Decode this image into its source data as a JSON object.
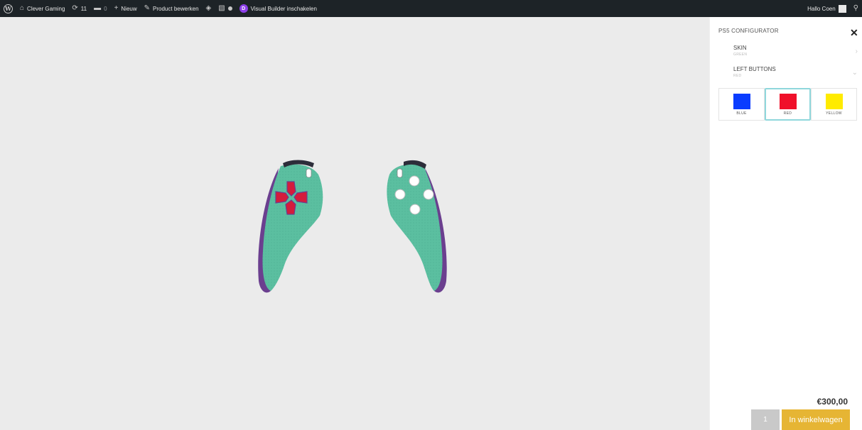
{
  "adminbar": {
    "site_name": "Clever Gaming",
    "updates_count": "11",
    "comments_count": "0",
    "new_label": "Nieuw",
    "edit_label": "Product bewerken",
    "visual_builder_label": "Visual Builder inschakelen",
    "greeting": "Hallo Coen"
  },
  "configurator": {
    "title": "PS5 CONFIGURATOR",
    "sections": [
      {
        "label": "SKIN",
        "value": "GREEN"
      },
      {
        "label": "LEFT BUTTONS",
        "value": "RED"
      }
    ],
    "options": [
      {
        "name": "BLUE",
        "color": "#0a3cff"
      },
      {
        "name": "RED",
        "color": "#f0102a"
      },
      {
        "name": "YELLOW",
        "color": "#ffeb00"
      }
    ],
    "selected_option": "RED",
    "price": "€300,00",
    "quantity": "1",
    "cart_label": "In winkelwagen"
  },
  "colors": {
    "shell": "#5bbfa0",
    "trim": "#6b3f8f",
    "buttons": "#d41c3c",
    "accent": "#e6b534",
    "highlight": "#8fd7dc"
  }
}
